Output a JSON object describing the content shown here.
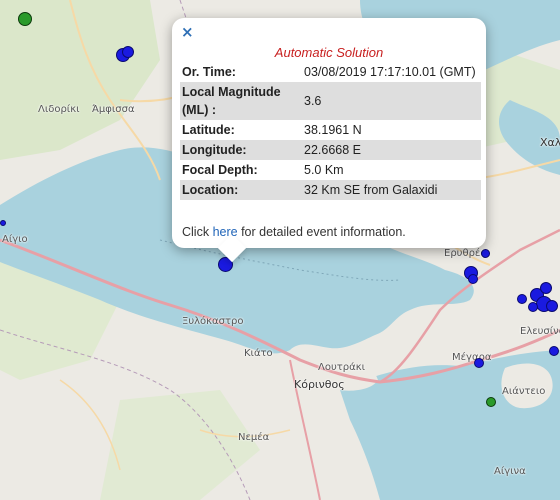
{
  "popup": {
    "close": "×",
    "title": "Automatic Solution",
    "rows": [
      {
        "label": "Or. Time:",
        "value": "03/08/2019 17:17:10.01 (GMT)"
      },
      {
        "label": "Local Magnitude (ML) :",
        "value": "3.6"
      },
      {
        "label": "Latitude:",
        "value": "38.1961 N"
      },
      {
        "label": "Longitude:",
        "value": "22.6668 E"
      },
      {
        "label": "Focal Depth:",
        "value": "5.0 Km"
      },
      {
        "label": "Location:",
        "value": "32 Km SE from Galaxidi"
      }
    ],
    "footer_pre": "Click ",
    "footer_link": "here",
    "footer_post": " for detailed event information."
  },
  "places": {
    "lidoriki": "Λιδορίκι",
    "amfissa": "Άμφισσα",
    "aigio": "Αίγιο",
    "xylokastro": "Ξυλόκαστρο",
    "kiato": "Κιάτο",
    "loutraki": "Λουτράκι",
    "korinthos": "Κόρινθος",
    "nemea": "Νεμέα",
    "erythres": "Ερυθρές",
    "megara": "Μέγαρα",
    "elefsina": "Ελευσίνα",
    "aiantio": "Αιάντειο",
    "aigina": "Αίγινα",
    "chalkida": "Χαλ"
  },
  "colors": {
    "sea": "#a9d2de",
    "land": "#eceae4",
    "forest": "#d7e6c3",
    "road_main": "#e7a0a6",
    "road_minor": "#f6d9a6",
    "marker_blue": "#1a1ae0",
    "marker_green": "#2a9a2a",
    "popup_title": "#c82020",
    "link": "#1f64b8"
  }
}
